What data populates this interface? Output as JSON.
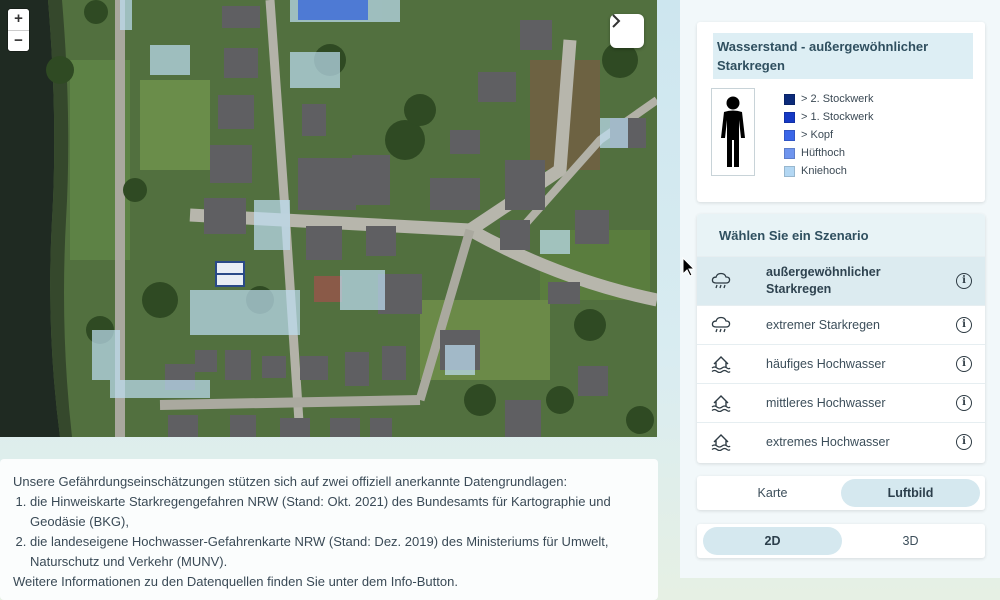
{
  "map": {
    "zoom_in": "+",
    "zoom_out": "−",
    "toggle_icon": "chevron-right-icon"
  },
  "info": {
    "intro": "Unsere Gefährdungseinschätzungen stützen sich auf zwei offiziell anerkannte Datengrundlagen:",
    "sources": [
      "die Hinweiskarte Starkregengefahren NRW (Stand: Okt. 2021) des Bundesamts für Kartographie und Geodäsie (BKG),",
      "die landeseigene Hochwasser-Gefahrenkarte NRW (Stand: Dez. 2019) des Ministeriums für Umwelt, Naturschutz und Verkehr (MUNV)."
    ],
    "outro": "Weitere Informationen zu den Datenquellen finden Sie unter dem Info-Button."
  },
  "legend": {
    "title": "Wasserstand - außergewöhnlicher Starkregen",
    "icon": "person-icon",
    "items": [
      {
        "label": "> 2. Stockwerk",
        "color": "#0b2a7a"
      },
      {
        "label": "> 1. Stockwerk",
        "color": "#1539c4"
      },
      {
        "label": "> Kopf",
        "color": "#3a66e8"
      },
      {
        "label": "Hüfthoch",
        "color": "#6f95ee"
      },
      {
        "label": "Kniehoch",
        "color": "#b3d7f3"
      }
    ]
  },
  "scenario": {
    "heading": "Wählen Sie ein Szenario",
    "items": [
      {
        "label": "außergewöhnlicher Starkregen",
        "icon": "rain-cloud-icon",
        "active": true
      },
      {
        "label": "extremer Starkregen",
        "icon": "rain-cloud-icon",
        "active": false
      },
      {
        "label": "häufiges Hochwasser",
        "icon": "flood-house-icon",
        "active": false
      },
      {
        "label": "mittleres Hochwasser",
        "icon": "flood-house-icon",
        "active": false
      },
      {
        "label": "extremes Hochwasser",
        "icon": "flood-house-icon",
        "active": false
      }
    ],
    "info_glyph": "i"
  },
  "basemap_toggle": {
    "options": [
      "Karte",
      "Luftbild"
    ],
    "selected": "Luftbild"
  },
  "view_toggle": {
    "options": [
      "2D",
      "3D"
    ],
    "selected": "2D"
  },
  "colors": {
    "accent": "#d5e8ef",
    "panel": "#f2f8fa"
  }
}
